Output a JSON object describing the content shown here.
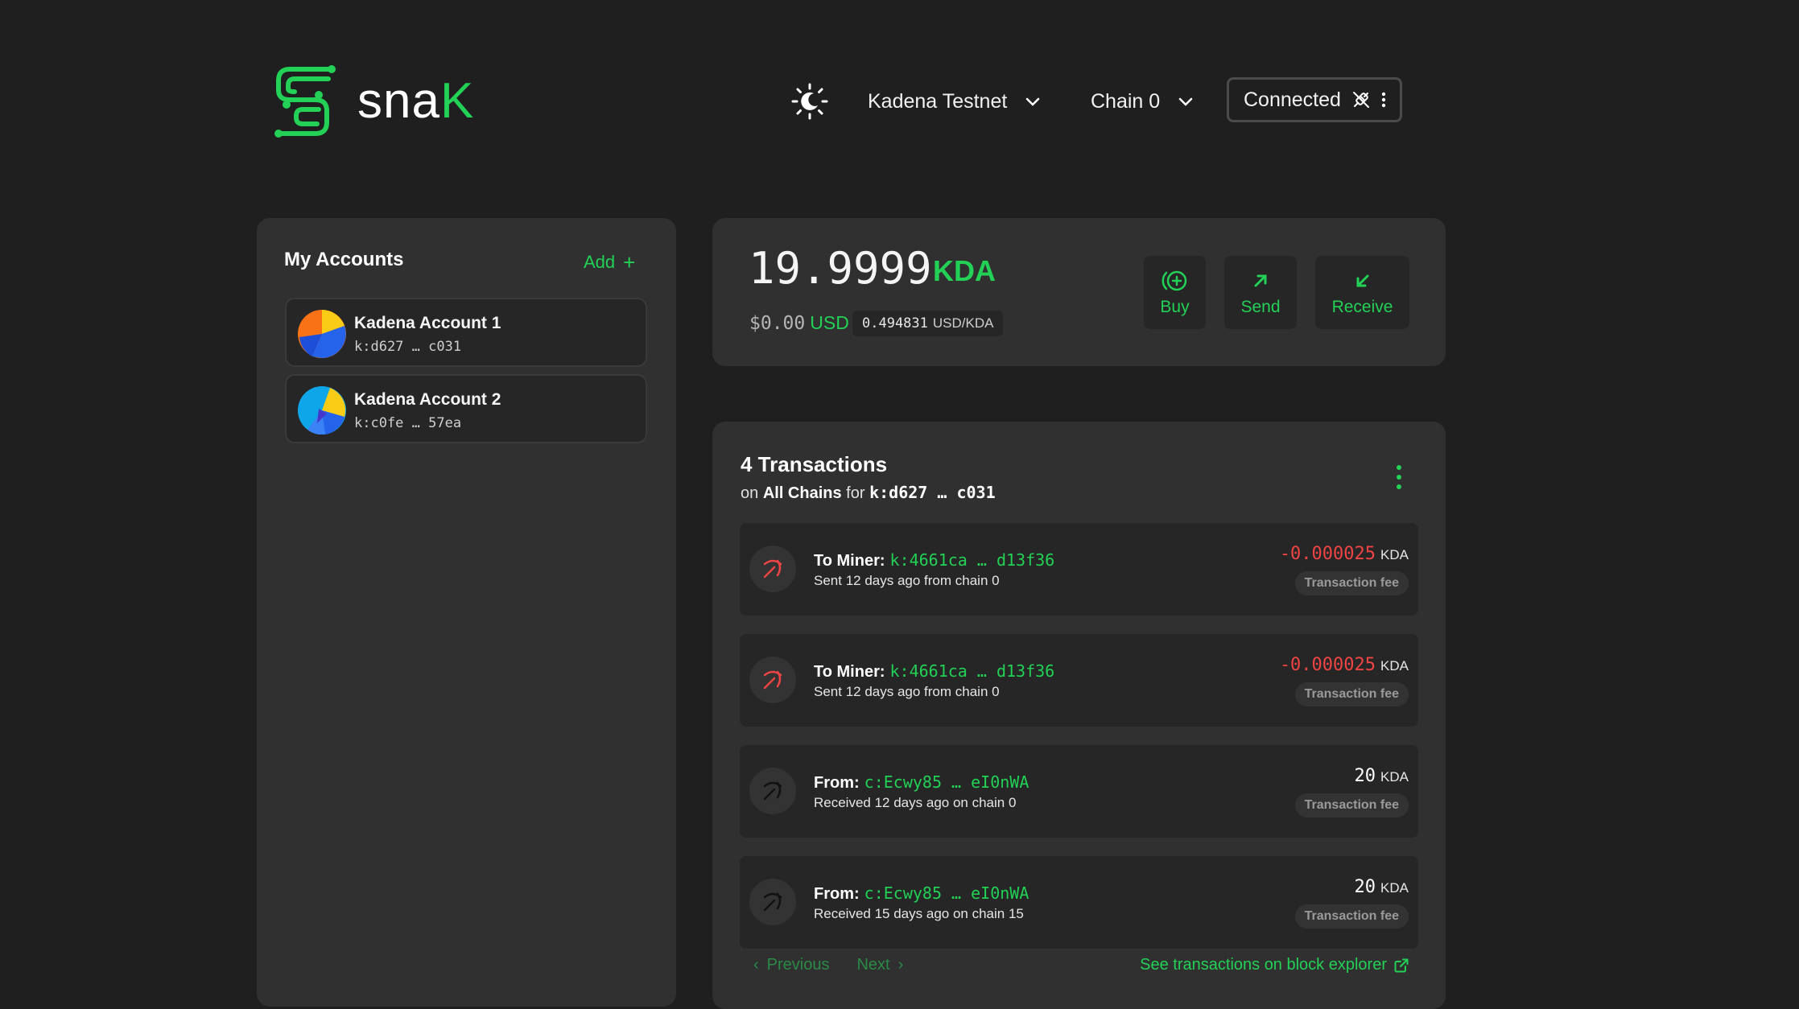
{
  "app": {
    "logo_text_main": "sna",
    "logo_text_accent": "K",
    "accent_color": "#22d156"
  },
  "header": {
    "network_label": "Kadena Testnet",
    "chain_label": "Chain 0",
    "connection_label": "Connected",
    "theme_icon": "theme-toggle-icon"
  },
  "accounts": {
    "title": "My Accounts",
    "add_label": "Add",
    "items": [
      {
        "name": "Kadena Account 1",
        "address": "k:d627 … c031"
      },
      {
        "name": "Kadena Account 2",
        "address": "k:c0fe … 57ea"
      }
    ]
  },
  "balance": {
    "amount": "19.9999",
    "unit": "KDA",
    "usd_value": "$0.00",
    "usd_label": "USD",
    "rate_value": "0.494831",
    "rate_unit": "USD/KDA",
    "actions": [
      {
        "label": "Buy",
        "icon": "buy-icon"
      },
      {
        "label": "Send",
        "icon": "send-arrow-icon"
      },
      {
        "label": "Receive",
        "icon": "receive-arrow-icon"
      }
    ]
  },
  "transactions": {
    "title": "4 Transactions",
    "sub_on": "on",
    "sub_chains": "All Chains",
    "sub_for": "for",
    "sub_address": "k:d627 … c031",
    "rows": [
      {
        "label": "To Miner:",
        "address": "k:4661ca … d13f36",
        "meta": "Sent 12 days ago from chain 0",
        "amount": "-0.000025",
        "unit": "KDA",
        "badge": "Transaction fee",
        "direction": "out"
      },
      {
        "label": "To Miner:",
        "address": "k:4661ca … d13f36",
        "meta": "Sent 12 days ago from chain 0",
        "amount": "-0.000025",
        "unit": "KDA",
        "badge": "Transaction fee",
        "direction": "out"
      },
      {
        "label": "From:",
        "address": "c:Ecwy85 … eI0nWA",
        "meta": "Received 12 days ago on chain 0",
        "amount": "20",
        "unit": "KDA",
        "badge": "Transaction fee",
        "direction": "in"
      },
      {
        "label": "From:",
        "address": "c:Ecwy85 … eI0nWA",
        "meta": "Received 15 days ago on chain 15",
        "amount": "20",
        "unit": "KDA",
        "badge": "Transaction fee",
        "direction": "in"
      }
    ],
    "previous_label": "Previous",
    "next_label": "Next",
    "explorer_label": "See transactions on block explorer"
  }
}
